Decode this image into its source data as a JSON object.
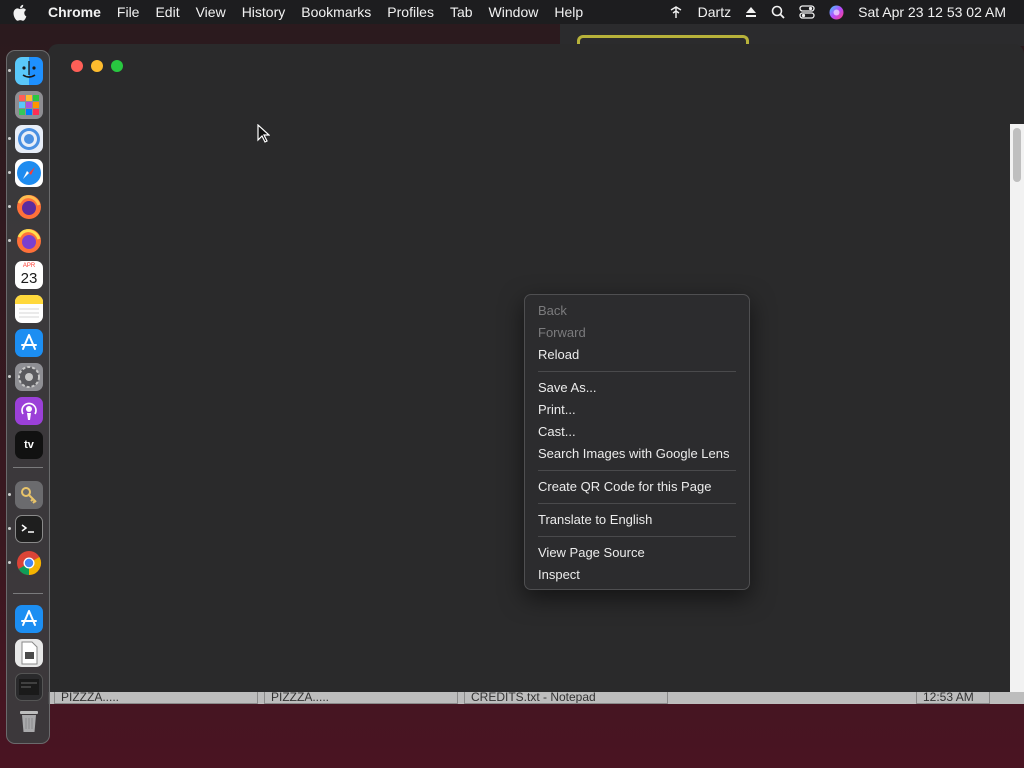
{
  "menubar": {
    "app_name": "Chrome",
    "items": [
      "File",
      "Edit",
      "View",
      "History",
      "Bookmarks",
      "Profiles",
      "Tab",
      "Window",
      "Help"
    ],
    "status_user": "Dartz",
    "datetime": "Sat Apr 23  12 53 02 AM"
  },
  "dock": {
    "calendar_month": "APR",
    "calendar_day": "23",
    "tv_label": "tv",
    "items": [
      "finder-icon",
      "launchpad-icon",
      "chrome-icon",
      "safari-icon",
      "firefox-icon",
      "firefox-dev-icon",
      "calendar-icon",
      "notes-icon",
      "app-store-icon",
      "system-preferences-icon",
      "podcasts-icon",
      "apple-tv-icon",
      "keychain-icon",
      "terminal-icon",
      "chrome-icon",
      "app-store-icon",
      "preview-icon",
      "screenshot-icon",
      "trash-icon"
    ]
  },
  "background_windows": {
    "taskbar_items": [
      "PIZZZA.....",
      "PIZZZA.....",
      "CREDITS.txt - Notepad",
      "12:53 AM"
    ]
  },
  "context_menu": {
    "back": "Back",
    "forward": "Forward",
    "reload": "Reload",
    "save_as": "Save As...",
    "print": "Print...",
    "cast": "Cast...",
    "search_images": "Search Images with Google Lens",
    "create_qr": "Create QR Code for this Page",
    "translate": "Translate to English",
    "view_source": "View Page Source",
    "inspect": "Inspect"
  },
  "colors": {
    "close": "#ff5f57",
    "minimize": "#febc2e",
    "zoom": "#28c840",
    "window_bg": "#2a2a2b",
    "menu_bg": "#2c2c2e"
  }
}
